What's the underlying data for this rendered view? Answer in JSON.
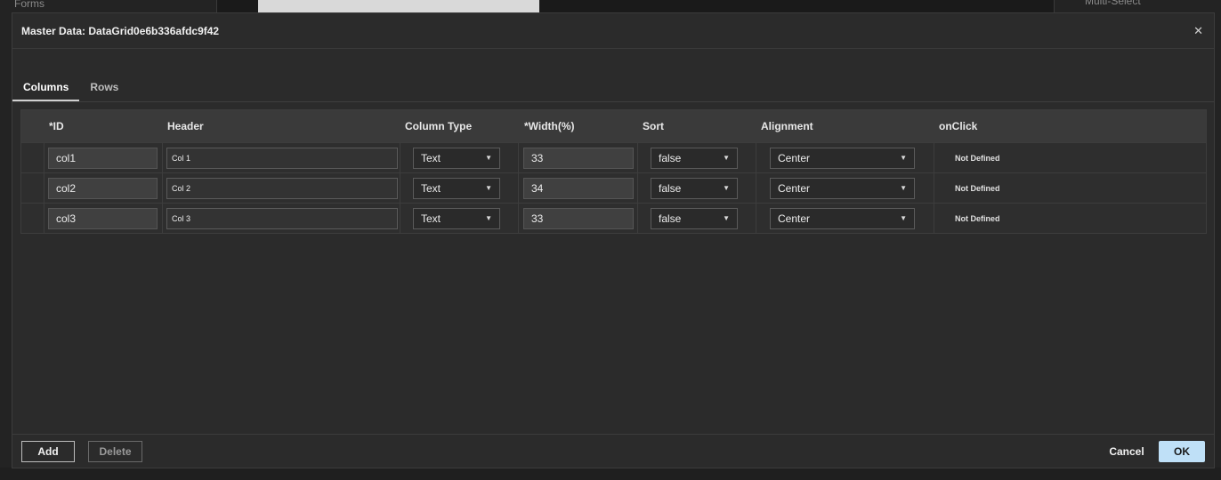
{
  "background": {
    "left_tree_item": "Forms",
    "right_panel_item": "Multi-Select"
  },
  "dialog": {
    "title": "Master Data: DataGrid0e6b336afdc9f42",
    "close_icon": "close-icon"
  },
  "tabs": [
    {
      "label": "Columns",
      "active": true
    },
    {
      "label": "Rows",
      "active": false
    }
  ],
  "grid": {
    "headers": {
      "id": "*ID",
      "header": "Header",
      "column_type": "Column Type",
      "width": "*Width(%)",
      "sort": "Sort",
      "alignment": "Alignment",
      "onclick": "onClick"
    },
    "rows": [
      {
        "id": "col1",
        "header": "Col 1",
        "column_type": "Text",
        "width": "33",
        "sort": "false",
        "alignment": "Center",
        "onclick": "Not Defined"
      },
      {
        "id": "col2",
        "header": "Col 2",
        "column_type": "Text",
        "width": "34",
        "sort": "false",
        "alignment": "Center",
        "onclick": "Not Defined"
      },
      {
        "id": "col3",
        "header": "Col 3",
        "column_type": "Text",
        "width": "33",
        "sort": "false",
        "alignment": "Center",
        "onclick": "Not Defined"
      }
    ]
  },
  "footer": {
    "add_label": "Add",
    "delete_label": "Delete",
    "cancel_label": "Cancel",
    "ok_label": "OK"
  },
  "colors": {
    "dialog_bg": "#2b2b2b",
    "primary_button": "#bfe0f7"
  }
}
